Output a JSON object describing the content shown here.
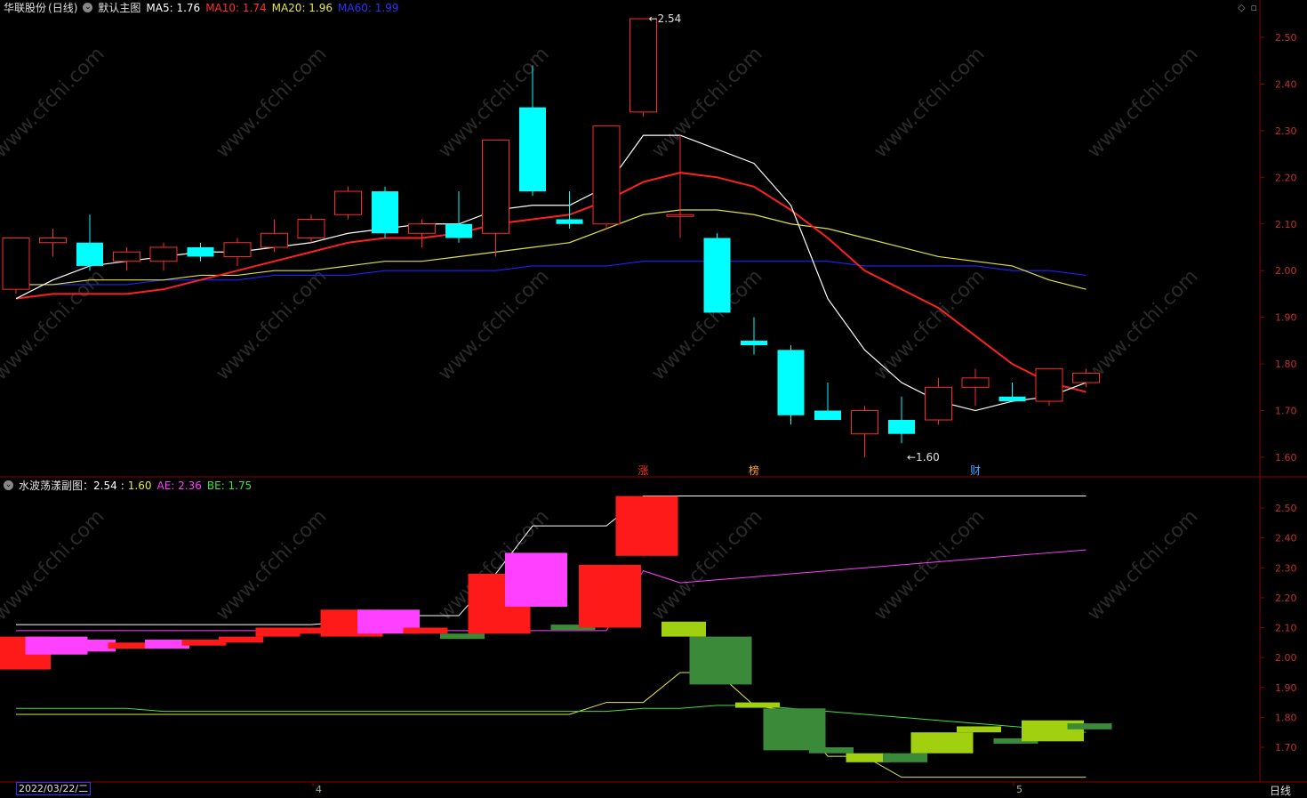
{
  "main_header": {
    "stock_name": "华联股份",
    "period": "(日线)",
    "chart_name": "默认主图",
    "ma5": "MA5: 1.76",
    "ma10": "MA10: 1.74",
    "ma20": "MA20: 1.96",
    "ma60": "MA60: 1.99"
  },
  "sub_header": {
    "name": "水波荡漾副图：",
    "v1": "2.54",
    "sep": ":",
    "v2": "1.60",
    "ae": "AE: 2.36",
    "be": "BE: 1.75"
  },
  "watermark": "www.cfchi.com",
  "date_box": "2022/03/22/二",
  "period_label": "日线",
  "colors": {
    "up": "#ff2a2a",
    "down": "#00ffff",
    "ma5": "#ffffff",
    "ma10": "#ff2020",
    "ma20": "#e0e040",
    "ma60": "#2020ff",
    "magenta": "#ff40ff",
    "lime": "#a0d010",
    "darkgreen": "#3a8a3a",
    "axis": "#8b0000"
  },
  "chart_data": [
    {
      "type": "candlestick",
      "title": "默认主图",
      "ylim": [
        1.56,
        2.56
      ],
      "yticks": [
        "2.50",
        "2.40",
        "2.30",
        "2.20",
        "2.10",
        "2.00",
        "1.90",
        "1.80",
        "1.70",
        "1.60"
      ],
      "x_ticks": [
        "4",
        "5"
      ],
      "annotations": [
        {
          "text": "2.54",
          "index": 17,
          "price": 2.54
        },
        {
          "text": "1.60",
          "index": 24,
          "price": 1.6
        }
      ],
      "markers": [
        {
          "text": "涨",
          "index": 17,
          "color": "#ff3030"
        },
        {
          "text": "榜",
          "index": 20,
          "color": "#ffa040"
        },
        {
          "text": "财",
          "index": 26,
          "color": "#4aa0ff"
        }
      ],
      "candles": [
        {
          "o": 1.96,
          "h": 2.07,
          "l": 1.95,
          "c": 2.07
        },
        {
          "o": 2.06,
          "h": 2.09,
          "l": 2.03,
          "c": 2.07
        },
        {
          "o": 2.06,
          "h": 2.12,
          "l": 2.0,
          "c": 2.01
        },
        {
          "o": 2.02,
          "h": 2.05,
          "l": 2.0,
          "c": 2.04
        },
        {
          "o": 2.02,
          "h": 2.06,
          "l": 2.0,
          "c": 2.05
        },
        {
          "o": 2.05,
          "h": 2.06,
          "l": 2.02,
          "c": 2.03
        },
        {
          "o": 2.03,
          "h": 2.07,
          "l": 2.01,
          "c": 2.06
        },
        {
          "o": 2.05,
          "h": 2.11,
          "l": 2.04,
          "c": 2.08
        },
        {
          "o": 2.07,
          "h": 2.12,
          "l": 2.06,
          "c": 2.11
        },
        {
          "o": 2.12,
          "h": 2.18,
          "l": 2.11,
          "c": 2.17
        },
        {
          "o": 2.17,
          "h": 2.18,
          "l": 2.07,
          "c": 2.08
        },
        {
          "o": 2.08,
          "h": 2.11,
          "l": 2.05,
          "c": 2.1
        },
        {
          "o": 2.1,
          "h": 2.17,
          "l": 2.06,
          "c": 2.07
        },
        {
          "o": 2.08,
          "h": 2.28,
          "l": 2.03,
          "c": 2.28
        },
        {
          "o": 2.35,
          "h": 2.44,
          "l": 2.16,
          "c": 2.17
        },
        {
          "o": 2.11,
          "h": 2.17,
          "l": 2.09,
          "c": 2.1
        },
        {
          "o": 2.1,
          "h": 2.31,
          "l": 2.09,
          "c": 2.31
        },
        {
          "o": 2.34,
          "h": 2.54,
          "l": 2.33,
          "c": 2.54
        },
        {
          "o": 2.12,
          "h": 2.29,
          "l": 2.07,
          "c": 2.12
        },
        {
          "o": 2.07,
          "h": 2.08,
          "l": 1.91,
          "c": 1.91
        },
        {
          "o": 1.85,
          "h": 1.9,
          "l": 1.82,
          "c": 1.84
        },
        {
          "o": 1.83,
          "h": 1.84,
          "l": 1.67,
          "c": 1.69
        },
        {
          "o": 1.7,
          "h": 1.76,
          "l": 1.69,
          "c": 1.68
        },
        {
          "o": 1.65,
          "h": 1.71,
          "l": 1.6,
          "c": 1.7
        },
        {
          "o": 1.68,
          "h": 1.73,
          "l": 1.63,
          "c": 1.65
        },
        {
          "o": 1.68,
          "h": 1.77,
          "l": 1.67,
          "c": 1.75
        },
        {
          "o": 1.75,
          "h": 1.79,
          "l": 1.71,
          "c": 1.77
        },
        {
          "o": 1.73,
          "h": 1.76,
          "l": 1.72,
          "c": 1.72
        },
        {
          "o": 1.72,
          "h": 1.79,
          "l": 1.71,
          "c": 1.79
        },
        {
          "o": 1.76,
          "h": 1.79,
          "l": 1.75,
          "c": 1.78
        }
      ],
      "ma5": [
        1.94,
        1.98,
        2.01,
        2.02,
        2.03,
        2.04,
        2.04,
        2.05,
        2.06,
        2.08,
        2.09,
        2.1,
        2.1,
        2.13,
        2.14,
        2.14,
        2.18,
        2.29,
        2.29,
        2.26,
        2.23,
        2.14,
        1.94,
        1.83,
        1.76,
        1.72,
        1.7,
        1.72,
        1.73,
        1.76
      ],
      "ma10": [
        1.94,
        1.95,
        1.95,
        1.95,
        1.96,
        1.98,
        2.0,
        2.02,
        2.04,
        2.06,
        2.07,
        2.07,
        2.08,
        2.1,
        2.11,
        2.12,
        2.15,
        2.19,
        2.21,
        2.2,
        2.18,
        2.13,
        2.07,
        2.0,
        1.96,
        1.92,
        1.86,
        1.8,
        1.76,
        1.74
      ],
      "ma20": [
        1.97,
        1.97,
        1.98,
        1.98,
        1.98,
        1.99,
        1.99,
        2.0,
        2.0,
        2.01,
        2.02,
        2.02,
        2.03,
        2.04,
        2.05,
        2.06,
        2.09,
        2.12,
        2.13,
        2.13,
        2.12,
        2.1,
        2.09,
        2.07,
        2.05,
        2.03,
        2.02,
        2.01,
        1.98,
        1.96
      ],
      "ma60": [
        1.97,
        1.97,
        1.97,
        1.97,
        1.98,
        1.98,
        1.98,
        1.99,
        1.99,
        1.99,
        2.0,
        2.0,
        2.0,
        2.0,
        2.01,
        2.01,
        2.01,
        2.02,
        2.02,
        2.02,
        2.02,
        2.02,
        2.02,
        2.01,
        2.01,
        2.01,
        2.01,
        2.0,
        2.0,
        1.99
      ]
    },
    {
      "type": "candlestick",
      "title": "水波荡漾副图",
      "ylim": [
        1.58,
        2.58
      ],
      "yticks": [
        "2.50",
        "2.40",
        "2.30",
        "2.20",
        "2.10",
        "2.00",
        "1.90",
        "1.80",
        "1.70"
      ],
      "blocks": [
        {
          "top": 2.07,
          "bottom": 1.96,
          "color": "red"
        },
        {
          "top": 2.07,
          "bottom": 2.01,
          "color": "magenta"
        },
        {
          "top": 2.06,
          "bottom": 2.02,
          "color": "magenta"
        },
        {
          "top": 2.05,
          "bottom": 2.03,
          "color": "red"
        },
        {
          "top": 2.06,
          "bottom": 2.03,
          "color": "magenta"
        },
        {
          "top": 2.06,
          "bottom": 2.04,
          "color": "red"
        },
        {
          "top": 2.07,
          "bottom": 2.05,
          "color": "red"
        },
        {
          "top": 2.1,
          "bottom": 2.07,
          "color": "red"
        },
        {
          "top": 2.1,
          "bottom": 2.08,
          "color": "red"
        },
        {
          "top": 2.16,
          "bottom": 2.07,
          "color": "red"
        },
        {
          "top": 2.16,
          "bottom": 2.08,
          "color": "magenta"
        },
        {
          "top": 2.1,
          "bottom": 2.08,
          "color": "red"
        },
        {
          "top": 2.08,
          "bottom": 2.07,
          "color": "darkgreen"
        },
        {
          "top": 2.28,
          "bottom": 2.08,
          "color": "red"
        },
        {
          "top": 2.35,
          "bottom": 2.17,
          "color": "magenta"
        },
        {
          "top": 2.11,
          "bottom": 2.1,
          "color": "darkgreen"
        },
        {
          "top": 2.31,
          "bottom": 2.1,
          "color": "red"
        },
        {
          "top": 2.54,
          "bottom": 2.34,
          "color": "red"
        },
        {
          "top": 2.12,
          "bottom": 2.07,
          "color": "lime"
        },
        {
          "top": 2.07,
          "bottom": 1.91,
          "color": "darkgreen"
        },
        {
          "top": 1.85,
          "bottom": 1.84,
          "color": "lime"
        },
        {
          "top": 1.83,
          "bottom": 1.69,
          "color": "darkgreen"
        },
        {
          "top": 1.7,
          "bottom": 1.68,
          "color": "darkgreen"
        },
        {
          "top": 1.68,
          "bottom": 1.65,
          "color": "lime"
        },
        {
          "top": 1.68,
          "bottom": 1.65,
          "color": "darkgreen"
        },
        {
          "top": 1.75,
          "bottom": 1.68,
          "color": "lime"
        },
        {
          "top": 1.77,
          "bottom": 1.75,
          "color": "lime"
        },
        {
          "top": 1.73,
          "bottom": 1.72,
          "color": "darkgreen"
        },
        {
          "top": 1.79,
          "bottom": 1.72,
          "color": "lime"
        },
        {
          "top": 1.78,
          "bottom": 1.76,
          "color": "darkgreen"
        }
      ],
      "upper_line": [
        2.11,
        2.11,
        2.11,
        2.11,
        2.11,
        2.11,
        2.11,
        2.11,
        2.11,
        2.12,
        2.14,
        2.14,
        2.14,
        2.28,
        2.44,
        2.44,
        2.44,
        2.54,
        2.54,
        2.54,
        2.54,
        2.54,
        2.54,
        2.54,
        2.54,
        2.54,
        2.54,
        2.54,
        2.54,
        2.54
      ],
      "lower_line": [
        1.81,
        1.81,
        1.81,
        1.81,
        1.81,
        1.81,
        1.81,
        1.81,
        1.81,
        1.81,
        1.81,
        1.81,
        1.81,
        1.81,
        1.81,
        1.81,
        1.85,
        1.85,
        1.95,
        1.95,
        1.84,
        1.82,
        1.67,
        1.67,
        1.6,
        1.6,
        1.6,
        1.6,
        1.6,
        1.6
      ],
      "ae": [
        2.09,
        2.09,
        2.09,
        2.09,
        2.09,
        2.09,
        2.09,
        2.09,
        2.09,
        2.09,
        2.09,
        2.09,
        2.09,
        2.09,
        2.09,
        2.09,
        2.09,
        2.29,
        2.25,
        2.26,
        2.27,
        2.28,
        2.29,
        2.3,
        2.31,
        2.32,
        2.33,
        2.34,
        2.35,
        2.36
      ],
      "be": [
        1.83,
        1.83,
        1.83,
        1.83,
        1.82,
        1.82,
        1.82,
        1.82,
        1.82,
        1.82,
        1.82,
        1.82,
        1.82,
        1.82,
        1.82,
        1.82,
        1.82,
        1.83,
        1.83,
        1.84,
        1.84,
        1.83,
        1.82,
        1.81,
        1.8,
        1.79,
        1.78,
        1.77,
        1.76,
        1.75
      ]
    }
  ]
}
